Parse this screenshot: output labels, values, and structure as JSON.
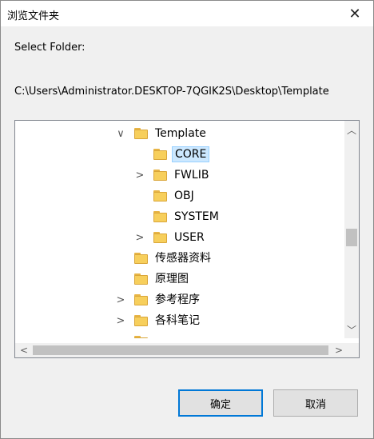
{
  "window": {
    "title": "浏览文件夹",
    "close_glyph": "✕"
  },
  "prompt": "Select Folder:",
  "path": "C:\\Users\\Administrator.DESKTOP-7QGIK2S\\Desktop\\Template",
  "tree": {
    "items": [
      {
        "label": "Template",
        "expander": "expanded"
      },
      {
        "label": "CORE",
        "expander": "none",
        "selected": true
      },
      {
        "label": "FWLIB",
        "expander": "collapsed"
      },
      {
        "label": "OBJ",
        "expander": "none"
      },
      {
        "label": "SYSTEM",
        "expander": "none"
      },
      {
        "label": "USER",
        "expander": "collapsed"
      },
      {
        "label": "传感器资料",
        "expander": "none"
      },
      {
        "label": "原理图",
        "expander": "none"
      },
      {
        "label": "参考程序",
        "expander": "collapsed"
      },
      {
        "label": "各科笔记",
        "expander": "collapsed"
      },
      {
        "label": "",
        "expander": "collapsed",
        "partial": true
      }
    ],
    "vertical_scroll_position": 0.55,
    "horizontal_scroll_position": 0.0
  },
  "scroll_glyphs": {
    "up": "︿",
    "down": "﹀",
    "left": "<",
    "right": ">",
    "chevron_expanded": "∨",
    "chevron_collapsed": ">"
  },
  "buttons": {
    "ok": "确定",
    "cancel": "取消"
  },
  "colors": {
    "selection_bg": "#cce8ff",
    "selection_border": "#99d1ff",
    "folder": "#f7cf5c",
    "default_button_border": "#0078d7"
  }
}
